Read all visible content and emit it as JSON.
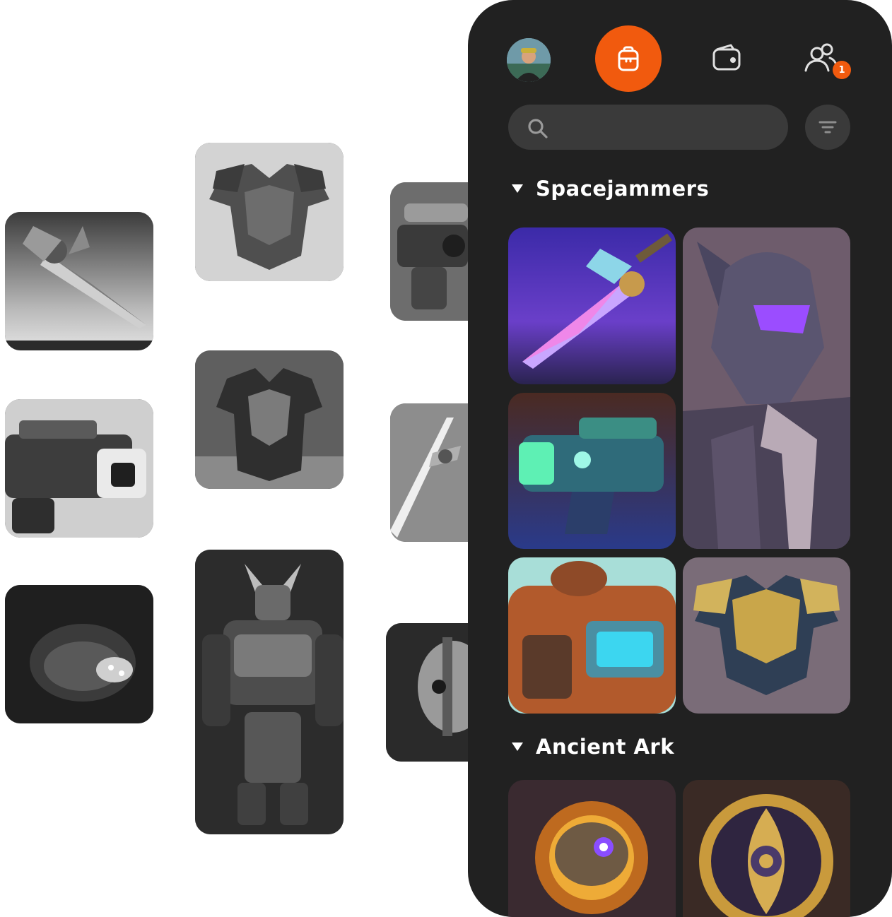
{
  "app": {
    "accent_color": "#f15a0e",
    "panel_color": "#212121"
  },
  "nav": {
    "profile_icon": "avatar",
    "inventory_icon": "backpack-icon",
    "wallet_icon": "wallet-icon",
    "friends_icon": "users-icon",
    "friends_badge": "1"
  },
  "search": {
    "value": "",
    "placeholder": ""
  },
  "sections": [
    {
      "title": "Spacejammers",
      "items": [
        "energy-sword",
        "armored-knight",
        "plasma-blaster",
        "mech-vehicle",
        "gold-chest-armor"
      ]
    },
    {
      "title": "Ancient Ark",
      "items": [
        "fire-orb",
        "golden-amulet"
      ]
    }
  ],
  "background_tiles": [
    "sword",
    "chest-armor",
    "blaster",
    "blaster-large",
    "chest-armor-2",
    "sword-2",
    "orb-device",
    "mech-robot",
    "skull-helmet"
  ]
}
